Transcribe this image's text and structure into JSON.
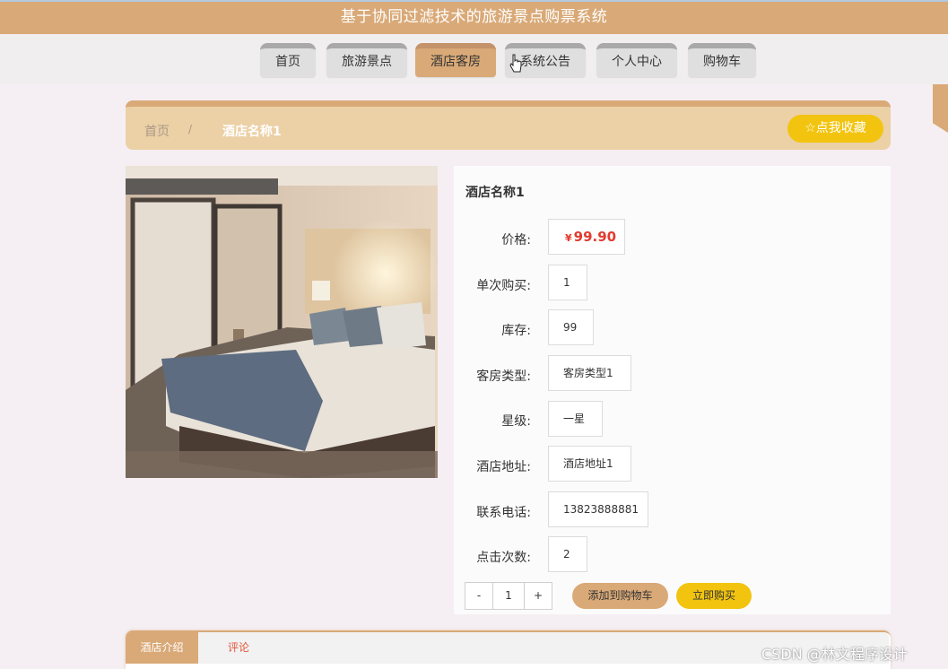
{
  "header": {
    "title": "基于协同过滤技术的旅游景点购票系统"
  },
  "nav": {
    "items": [
      {
        "label": "首页"
      },
      {
        "label": "旅游景点"
      },
      {
        "label": "酒店客房"
      },
      {
        "label": "系统公告"
      },
      {
        "label": "个人中心"
      },
      {
        "label": "购物车"
      }
    ],
    "active": "酒店客房"
  },
  "breadcrumb": {
    "home": "首页",
    "separator": "/",
    "current": "酒店名称1"
  },
  "favorite_button": {
    "label": "☆点我收藏",
    "icon": "star-outline-icon"
  },
  "product": {
    "name": "酒店名称1",
    "fields": [
      {
        "label": "价格:",
        "currency": "¥",
        "value": "99.90"
      },
      {
        "label": "单次购买:",
        "value": "1"
      },
      {
        "label": "库存:",
        "value": "99"
      },
      {
        "label": "客房类型:",
        "value": "客房类型1"
      },
      {
        "label": "星级:",
        "value": "一星"
      },
      {
        "label": "酒店地址:",
        "value": "酒店地址1"
      },
      {
        "label": "联系电话:",
        "value": "13823888881"
      },
      {
        "label": "点击次数:",
        "value": "2"
      }
    ]
  },
  "quantity": {
    "minus": "-",
    "value": "1",
    "plus": "+"
  },
  "actions": {
    "add_to_cart": "添加到购物车",
    "buy_now": "立即购买"
  },
  "tabs": {
    "intro": "酒店介绍",
    "comments": "评论"
  },
  "watermark": "CSDN @林文程序设计",
  "colors": {
    "accent": "#d9a977",
    "highlight": "#f2c40f",
    "price": "#e23a2e"
  }
}
